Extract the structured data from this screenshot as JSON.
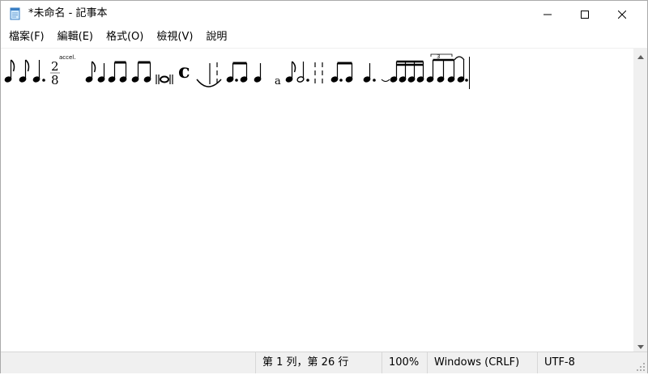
{
  "window": {
    "title": "*未命名 - 記事本",
    "icon": "notepad-icon"
  },
  "titlebar": {
    "minimize_icon": "minimize-icon",
    "maximize_icon": "maximize-icon",
    "close_icon": "close-icon"
  },
  "menu": {
    "items": [
      {
        "label": "檔案(F)"
      },
      {
        "label": "編輯(E)"
      },
      {
        "label": "格式(O)"
      },
      {
        "label": "檢視(V)"
      },
      {
        "label": "說明"
      }
    ]
  },
  "editor": {
    "annotation_accel": "accel.",
    "time_sig_top": "2",
    "time_sig_bottom": "8",
    "common_time": "c",
    "letter_a": "a",
    "triplet": "3",
    "content_icon": "music-notation-icon"
  },
  "statusbar": {
    "position": "第 1 列，第 26 行",
    "zoom": "100%",
    "line_ending": "Windows (CRLF)",
    "encoding": "UTF-8"
  }
}
